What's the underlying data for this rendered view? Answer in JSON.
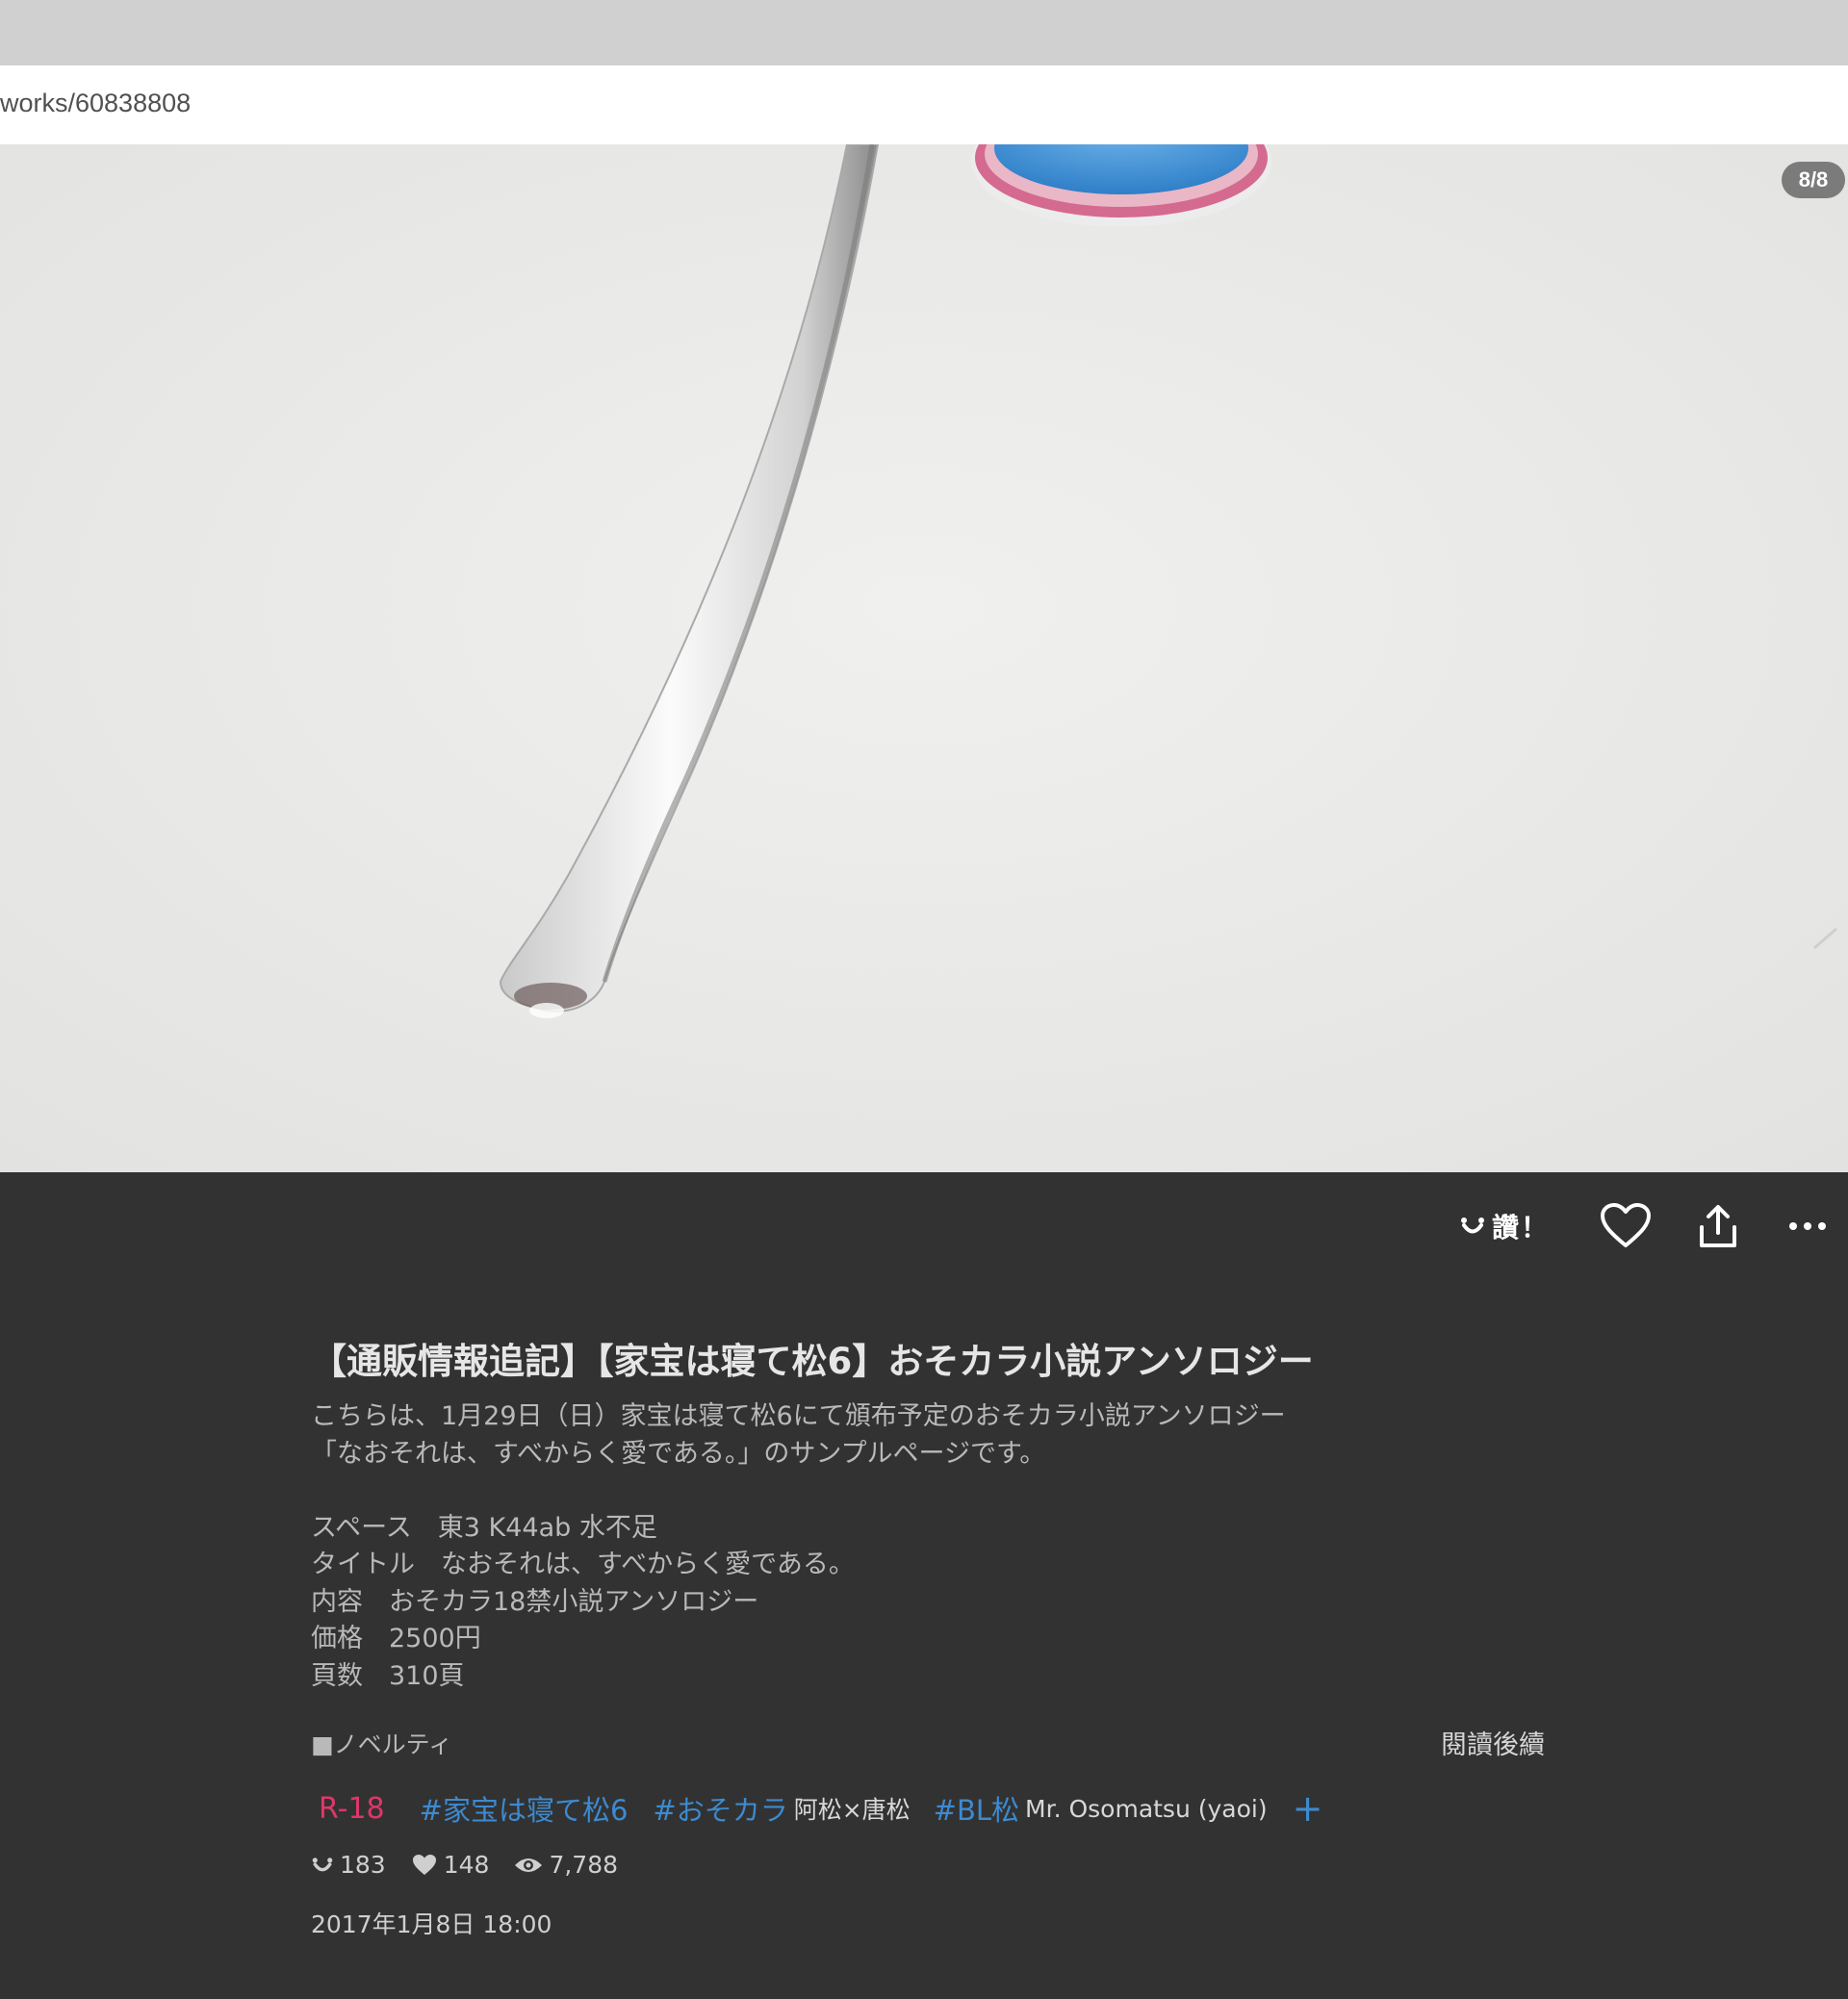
{
  "browser": {
    "url": "works/60838808"
  },
  "viewer": {
    "page_indicator": "8/8"
  },
  "actions": {
    "good_deed_label": "讚！"
  },
  "work": {
    "title": "【通販情報追記】【家宝は寝て松6】おそカラ小説アンソロジー",
    "description_lines": [
      "こちらは、1月29日（日）家宝は寝て松6にて頒布予定のおそカラ小説アンソロジー",
      "「なおそれは、すべからく愛である。」のサンプルページです。",
      "",
      "スペース　東3 K44ab 水不足",
      "タイトル　なおそれは、すべからく愛である。",
      "内容　おそカラ18禁小説アンソロジー",
      "価格　2500円",
      "頁数　310頁"
    ],
    "novelty_label": "■ノベルティ",
    "read_more": "閱讀後續",
    "rating": "R-18",
    "tags": [
      {
        "tag": "#家宝は寝て松6",
        "translation": ""
      },
      {
        "tag": "#おそカラ",
        "translation": "阿松×唐松"
      },
      {
        "tag": "#BL松",
        "translation": "Mr. Osomatsu (yaoi)"
      }
    ],
    "add_tag": "+",
    "stats": {
      "good_deeds": "183",
      "likes": "148",
      "views": "7,788"
    },
    "posted_date": "2017年1月8日 18:00"
  },
  "colors": {
    "background": "#323232",
    "rating": "#e0366a",
    "tag": "#3d8ad0"
  }
}
